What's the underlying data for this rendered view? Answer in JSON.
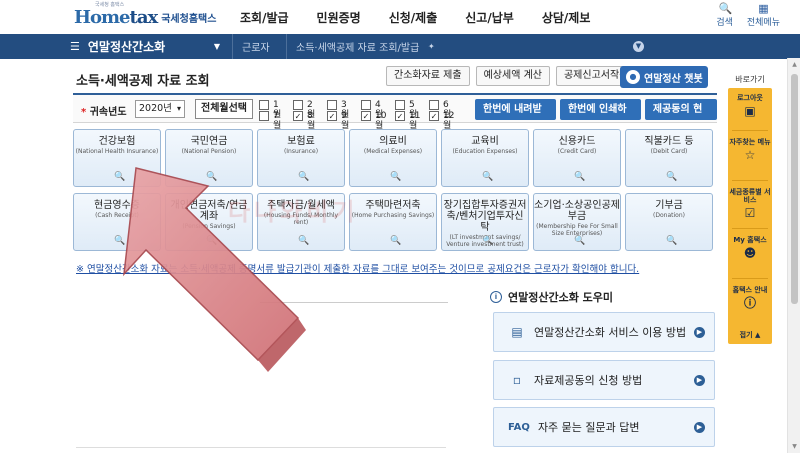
{
  "header": {
    "logo_sub": "국세청 홈택스",
    "logo_main_home": "Home",
    "logo_main_tax": "tax",
    "logo_org": "국세청홈택스",
    "nav": [
      "조회/발급",
      "민원증명",
      "신청/제출",
      "신고/납부",
      "상담/제보"
    ],
    "icons": [
      {
        "label": "검색",
        "icon": "search-icon"
      },
      {
        "label": "전체메뉴",
        "icon": "grid-menu-icon"
      }
    ]
  },
  "navstrip": {
    "menu_label": "연말정산간소화",
    "crumbs": [
      "근로자",
      "소득·세액공제 자료 조회/발급"
    ]
  },
  "page": {
    "title": "소득·세액공제 자료 조회",
    "tool_buttons": [
      "간소화자료 제출",
      "예상세액 계산",
      "공제신고서작성"
    ],
    "chat_button": "연말정산 챗봇"
  },
  "filter": {
    "year_label": "귀속년도",
    "year_value": "2020년",
    "all_button": "전체월선택",
    "months": [
      {
        "label": "1월",
        "checked": false
      },
      {
        "label": "2월",
        "checked": false
      },
      {
        "label": "3월",
        "checked": false
      },
      {
        "label": "4월",
        "checked": false
      },
      {
        "label": "5월",
        "checked": false
      },
      {
        "label": "6월",
        "checked": false
      },
      {
        "label": "7월",
        "checked": false
      },
      {
        "label": "8월",
        "checked": true
      },
      {
        "label": "9월",
        "checked": true
      },
      {
        "label": "10월",
        "checked": true
      },
      {
        "label": "11월",
        "checked": true
      },
      {
        "label": "12월",
        "checked": true
      }
    ],
    "action_buttons": [
      "한번에 내려받기",
      "한번에 인쇄하기",
      "제공동의 현황"
    ]
  },
  "categories": [
    {
      "ko": "건강보험",
      "en": "(National Health Insurance)"
    },
    {
      "ko": "국민연금",
      "en": "(National Pension)"
    },
    {
      "ko": "보험료",
      "en": "(Insurance)"
    },
    {
      "ko": "의료비",
      "en": "(Medical Expenses)"
    },
    {
      "ko": "교육비",
      "en": "(Education Expenses)"
    },
    {
      "ko": "신용카드",
      "en": "(Credit Card)"
    },
    {
      "ko": "직불카드 등",
      "en": "(Debit Card)"
    },
    {
      "ko": "현금영수증",
      "en": "(Cash Receipt)"
    },
    {
      "ko": "개인연금저축/연금계좌",
      "en": "(Pension Savings)"
    },
    {
      "ko": "주택자금/월세액",
      "en": "(Housing Funds/ Monthly rent)"
    },
    {
      "ko": "주택마련저축",
      "en": "(Home Purchasing Savings)"
    },
    {
      "ko": "장기집합투자증권저축/벤처기업투자신탁",
      "en": "(LT investment savings/ Venture investment trust)"
    },
    {
      "ko": "소기업·소상공인공제부금",
      "en": "(Membership Fee For Small Size Enterprises)"
    },
    {
      "ko": "기부금",
      "en": "(Donation)"
    }
  ],
  "notice": "※ 연말정산간소화 자료는 소득·세액공제 증명서류 발급기관이 제출한 자료를 그대로 보여주는 것이므로 공제요건은 근로자가 확인해야 합니다.",
  "helper": {
    "title": "연말정산간소화 도우미",
    "cards": [
      {
        "label": "연말정산간소화 서비스 이용 방법",
        "icon": "document-icon"
      },
      {
        "label": "자료제공동의 신청 방법",
        "icon": "form-icon"
      },
      {
        "label": "자주 묻는 질문과 답변",
        "icon": "faq-icon",
        "prefix": "FAQ"
      }
    ]
  },
  "quick_menu": {
    "title": "바로가기",
    "items": [
      {
        "label": "로그아웃",
        "icon": "lock-icon"
      },
      {
        "label": "자주찾는 메뉴",
        "icon": "star-icon"
      },
      {
        "label": "세금종류별 서비스",
        "icon": "checklist-icon"
      },
      {
        "label": "My 홈택스",
        "icon": "user-icon"
      },
      {
        "label": "홈택스 안내",
        "icon": "info-icon"
      }
    ],
    "close_label": "접기"
  },
  "watermark": "다나와비기"
}
